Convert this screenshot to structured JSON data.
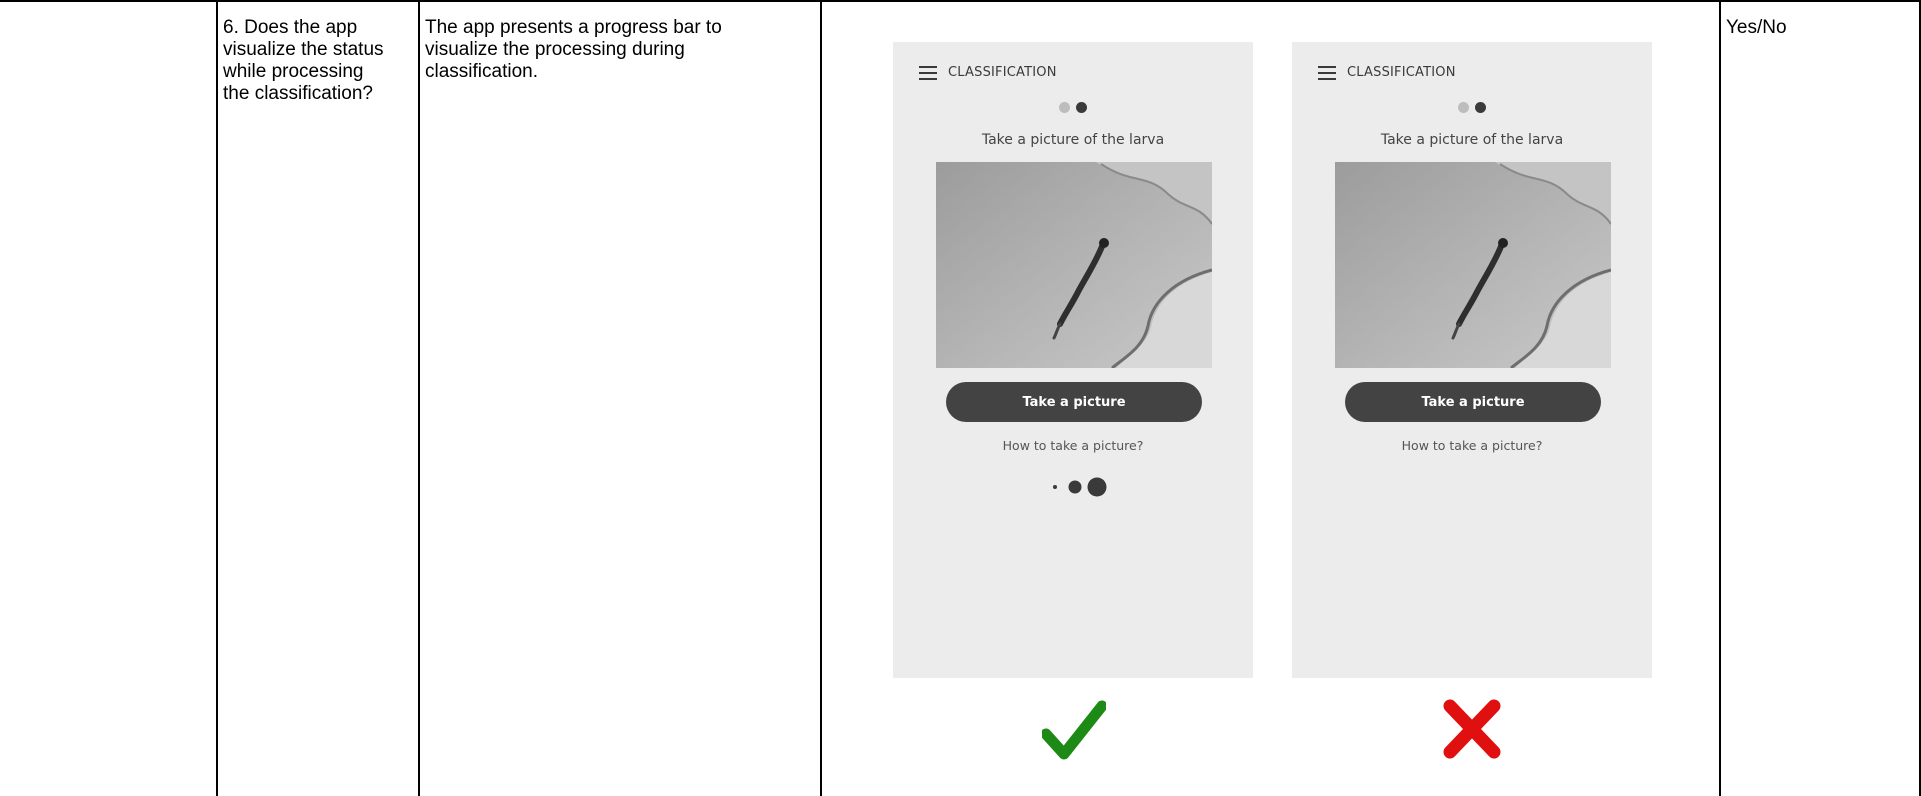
{
  "row": {
    "criterion": "6. Does the app visualize the status while processing the classification?",
    "criterion_lines": [
      "6. Does the app",
      "visualize the status",
      "while processing",
      "the classification?"
    ],
    "description_lines": [
      "The app presents a progress bar to",
      "visualize the processing during",
      "classification."
    ],
    "answer": "Yes/No"
  },
  "mockups": [
    {
      "title": "CLASSIFICATION",
      "instruction": "Take a picture of the larva",
      "button_label": "Take a picture",
      "help_link": "How to take a picture?",
      "shows_progress_indicator": true,
      "verdict": "correct",
      "verdict_icon": "check-icon",
      "verdict_color": "#1e8a16"
    },
    {
      "title": "CLASSIFICATION",
      "instruction": "Take a picture of the larva",
      "button_label": "Take a picture",
      "help_link": "How to take a picture?",
      "shows_progress_indicator": false,
      "verdict": "incorrect",
      "verdict_icon": "cross-icon",
      "verdict_color": "#e01010"
    }
  ],
  "colors": {
    "phone_background": "#ececec",
    "button": "#434343",
    "correct": "#1e8a16",
    "incorrect": "#e01010"
  }
}
